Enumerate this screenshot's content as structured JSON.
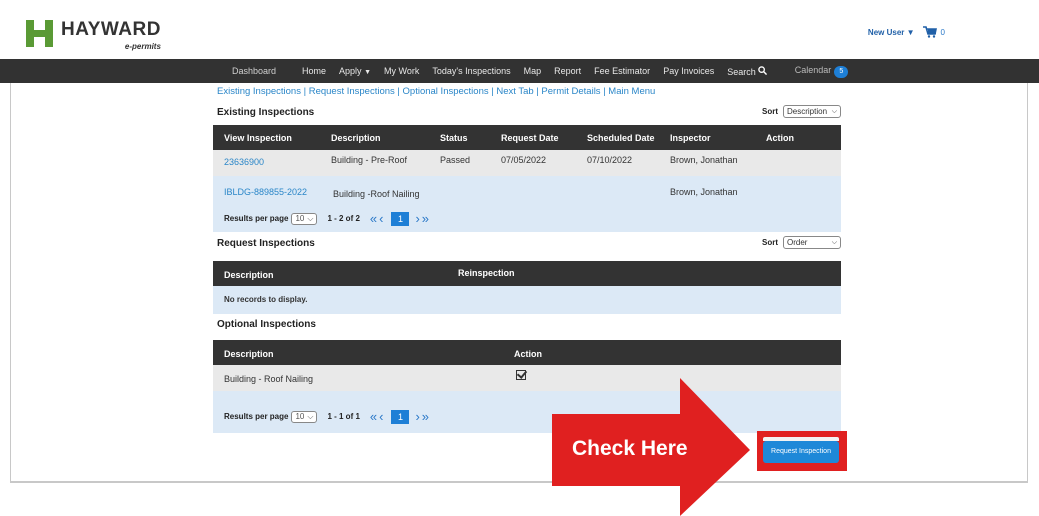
{
  "header": {
    "logo_name": "HAYWARD",
    "logo_sub": "e-permits",
    "user_menu": "New User",
    "cart_count": "0"
  },
  "nav": {
    "items": [
      "Dashboard",
      "Home",
      "Apply",
      "My Work",
      "Today's Inspections",
      "Map",
      "Report",
      "Fee Estimator",
      "Pay Invoices",
      "Search"
    ],
    "calendar_label": "Calendar",
    "calendar_count": "5"
  },
  "sublinks": "Existing Inspections | Request Inspections | Optional Inspections | Next Tab | Permit Details | Main Menu",
  "existing": {
    "title": "Existing Inspections",
    "sort_label": "Sort",
    "sort_value": "Description",
    "columns": [
      "View Inspection",
      "Description",
      "Status",
      "Request Date",
      "Scheduled Date",
      "Inspector",
      "Action"
    ],
    "rows": [
      [
        "23636900",
        "Building - Pre-Roof",
        "Passed",
        "07/05/2022",
        "07/10/2022",
        "Brown, Jonathan",
        ""
      ],
      [
        "IBLDG-889855-2022",
        "Building -Roof Nailing",
        "",
        "",
        "",
        "Brown, Jonathan",
        ""
      ]
    ],
    "pager": {
      "label": "Results per page",
      "per_page": "10",
      "range": "1 - 2 of 2",
      "page": "1"
    }
  },
  "request": {
    "title": "Request Inspections",
    "sort_label": "Sort",
    "sort_value": "Order",
    "columns": [
      "Description",
      "Reinspection"
    ],
    "empty": "No records to display."
  },
  "optional": {
    "title": "Optional Inspections",
    "columns": [
      "Description",
      "Action"
    ],
    "rows": [
      [
        "Building - Roof Nailing"
      ]
    ],
    "pager": {
      "label": "Results per page",
      "per_page": "10",
      "range": "1 - 1 of 1",
      "page": "1"
    }
  },
  "callout": {
    "label": "Check Here",
    "color": "#e02020"
  },
  "request_button": "Request Inspection"
}
